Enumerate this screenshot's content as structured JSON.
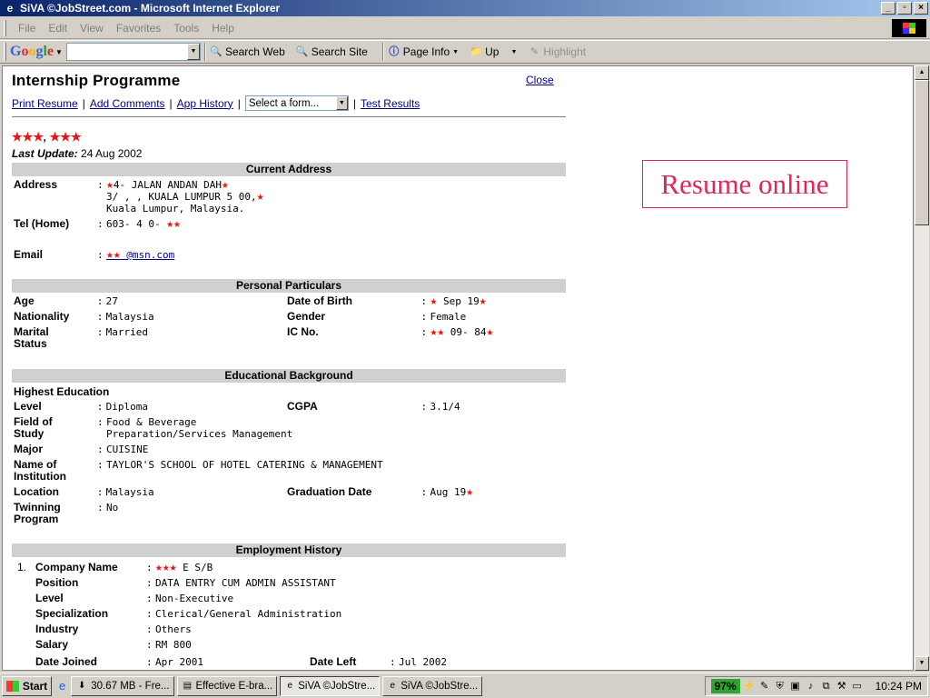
{
  "window": {
    "title": "SiVA ©JobStreet.com - Microsoft Internet Explorer"
  },
  "menu": [
    "File",
    "Edit",
    "View",
    "Favorites",
    "Tools",
    "Help"
  ],
  "toolbar": {
    "search_web": "Search Web",
    "search_site": "Search Site",
    "page_info": "Page Info",
    "up": "Up",
    "highlight": "Highlight"
  },
  "page": {
    "title": "Internship Programme",
    "close": "Close",
    "links": {
      "print_resume": "Print Resume",
      "add_comments": "Add Comments",
      "app_history": "App History",
      "select_form": "Select a form...",
      "test_results": "Test Results"
    },
    "name_visible": ", ",
    "last_update_label": "Last Update:",
    "last_update_value": "24 Aug 2002",
    "resume_online": "Resume online"
  },
  "current_address": {
    "header": "Current Address",
    "address_label": "Address",
    "address_line1": "4-  JALAN  ANDAN  DAH",
    "address_line2": "3/ , , KUALA LUMPUR  5 00,",
    "address_line3": "Kuala Lumpur, Malaysia.",
    "tel_label": "Tel (Home)",
    "tel_value": "603- 4 0- ",
    "email_label": "Email",
    "email_value": "  @msn.com"
  },
  "personal": {
    "header": "Personal Particulars",
    "age_label": "Age",
    "age_value": "27",
    "dob_label": "Date of Birth",
    "dob_value": " Sep 19",
    "nationality_label": "Nationality",
    "nationality_value": "Malaysia",
    "gender_label": "Gender",
    "gender_value": "Female",
    "marital_label1": "Marital",
    "marital_label2": "Status",
    "marital_value": "Married",
    "ic_label": "IC No.",
    "ic_value": "  09-  84"
  },
  "education": {
    "header": "Educational Background",
    "highest": "Highest Education",
    "level_label": "Level",
    "level_value": "Diploma",
    "cgpa_label": "CGPA",
    "cgpa_value": "3.1/4",
    "field_label1": "Field of",
    "field_label2": "Study",
    "field_value1": "Food & Beverage",
    "field_value2": "Preparation/Services Management",
    "major_label": "Major",
    "major_value": "CUISINE",
    "inst_label1": "Name of",
    "inst_label2": "Institution",
    "inst_value": "TAYLOR'S SCHOOL OF HOTEL CATERING & MANAGEMENT",
    "location_label": "Location",
    "location_value": "Malaysia",
    "grad_label": "Graduation Date",
    "grad_value": "Aug  19",
    "twin_label1": "Twinning",
    "twin_label2": "Program",
    "twin_value": "No"
  },
  "employment": {
    "header": "Employment History",
    "index": "1.",
    "company_label": "Company Name",
    "company_value": "   E S/B",
    "position_label": "Position",
    "position_value": "DATA ENTRY CUM ADMIN ASSISTANT",
    "level_label": "Level",
    "level_value": "Non-Executive",
    "spec_label": "Specialization",
    "spec_value": "Clerical/General Administration",
    "industry_label": "Industry",
    "industry_value": "Others",
    "salary_label": "Salary",
    "salary_value": "RM 800",
    "joined_label": "Date Joined",
    "joined_value": "Apr 2001",
    "left_label": "Date Left",
    "left_value": "Jul 2002"
  },
  "taskbar": {
    "start": "Start",
    "tasks": [
      "30.67 MB - Fre...",
      "Effective E-bra...",
      "SiVA ©JobStre...",
      "SiVA ©JobStre..."
    ],
    "battery": "97%",
    "clock": "10:24 PM"
  },
  "colors": {
    "link": "#000080",
    "section_bg": "#d0d0d0",
    "resume_accent": "#e0245e",
    "redaction_star": "#ee1111"
  }
}
